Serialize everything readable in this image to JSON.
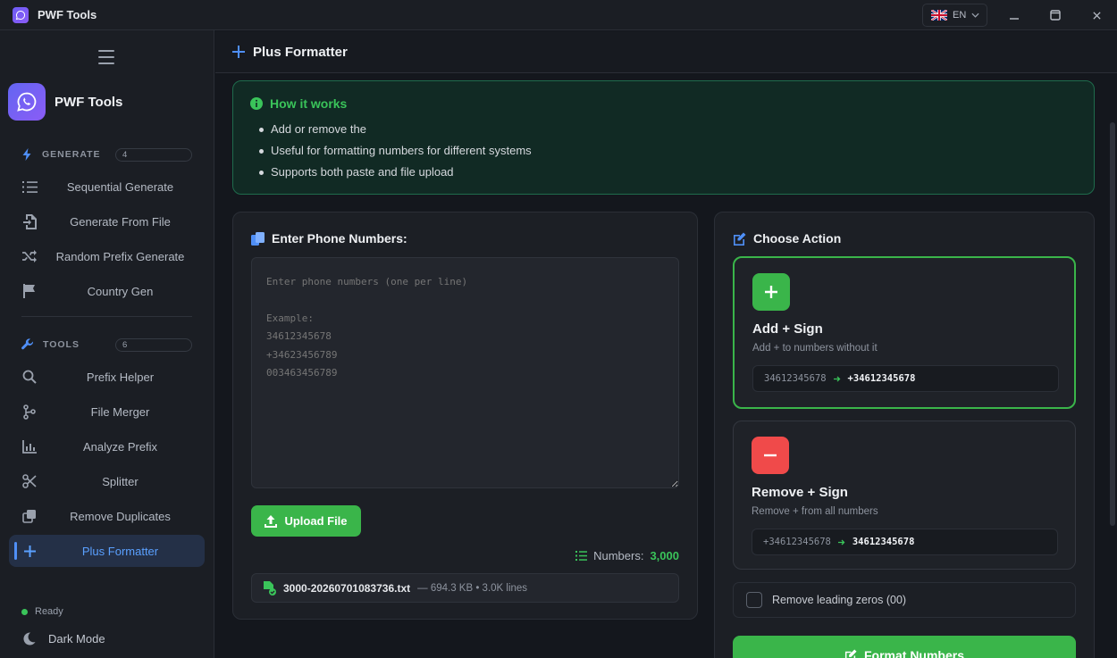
{
  "window": {
    "title": "PWF Tools",
    "language": "EN"
  },
  "sidebar": {
    "brand": "PWF Tools",
    "sections": {
      "generate": {
        "label": "GENERATE",
        "count": "4",
        "items": [
          "Sequential Generate",
          "Generate From File",
          "Random Prefix Generate",
          "Country Gen"
        ]
      },
      "tools": {
        "label": "TOOLS",
        "count": "6",
        "items": [
          "Prefix Helper",
          "File Merger",
          "Analyze Prefix",
          "Splitter",
          "Remove Duplicates",
          "Plus Formatter"
        ]
      }
    },
    "status": "Ready",
    "dark_mode_label": "Dark Mode"
  },
  "main": {
    "page_title": "Plus Formatter",
    "how_it_works": {
      "title": "How it works",
      "points": [
        "Add or remove the",
        "Useful for formatting numbers for different systems",
        "Supports both paste and file upload"
      ]
    },
    "input_card": {
      "title": "Enter Phone Numbers:",
      "placeholder": "Enter phone numbers (one per line)\n\nExample:\n34612345678\n+34623456789\n003463456789",
      "upload_label": "Upload File",
      "numbers_label": "Numbers:",
      "numbers_value": "3,000",
      "file_name": "3000-20260701083736.txt",
      "file_meta": "— 694.3 KB • 3.0K lines"
    },
    "action_card": {
      "title": "Choose Action",
      "add": {
        "title": "Add + Sign",
        "description": "Add + to numbers without it",
        "example_from": "34612345678",
        "example_to": "+34612345678"
      },
      "remove": {
        "title": "Remove + Sign",
        "description": "Remove + from all numbers",
        "example_from": "+34612345678",
        "example_to": "34612345678"
      },
      "checkbox_label": "Remove leading zeros (00)",
      "format_button": "Format Numbers"
    }
  },
  "colors": {
    "accent_green": "#3ab54a",
    "accent_red": "#f04a4a",
    "accent_blue": "#4f8ff7"
  }
}
